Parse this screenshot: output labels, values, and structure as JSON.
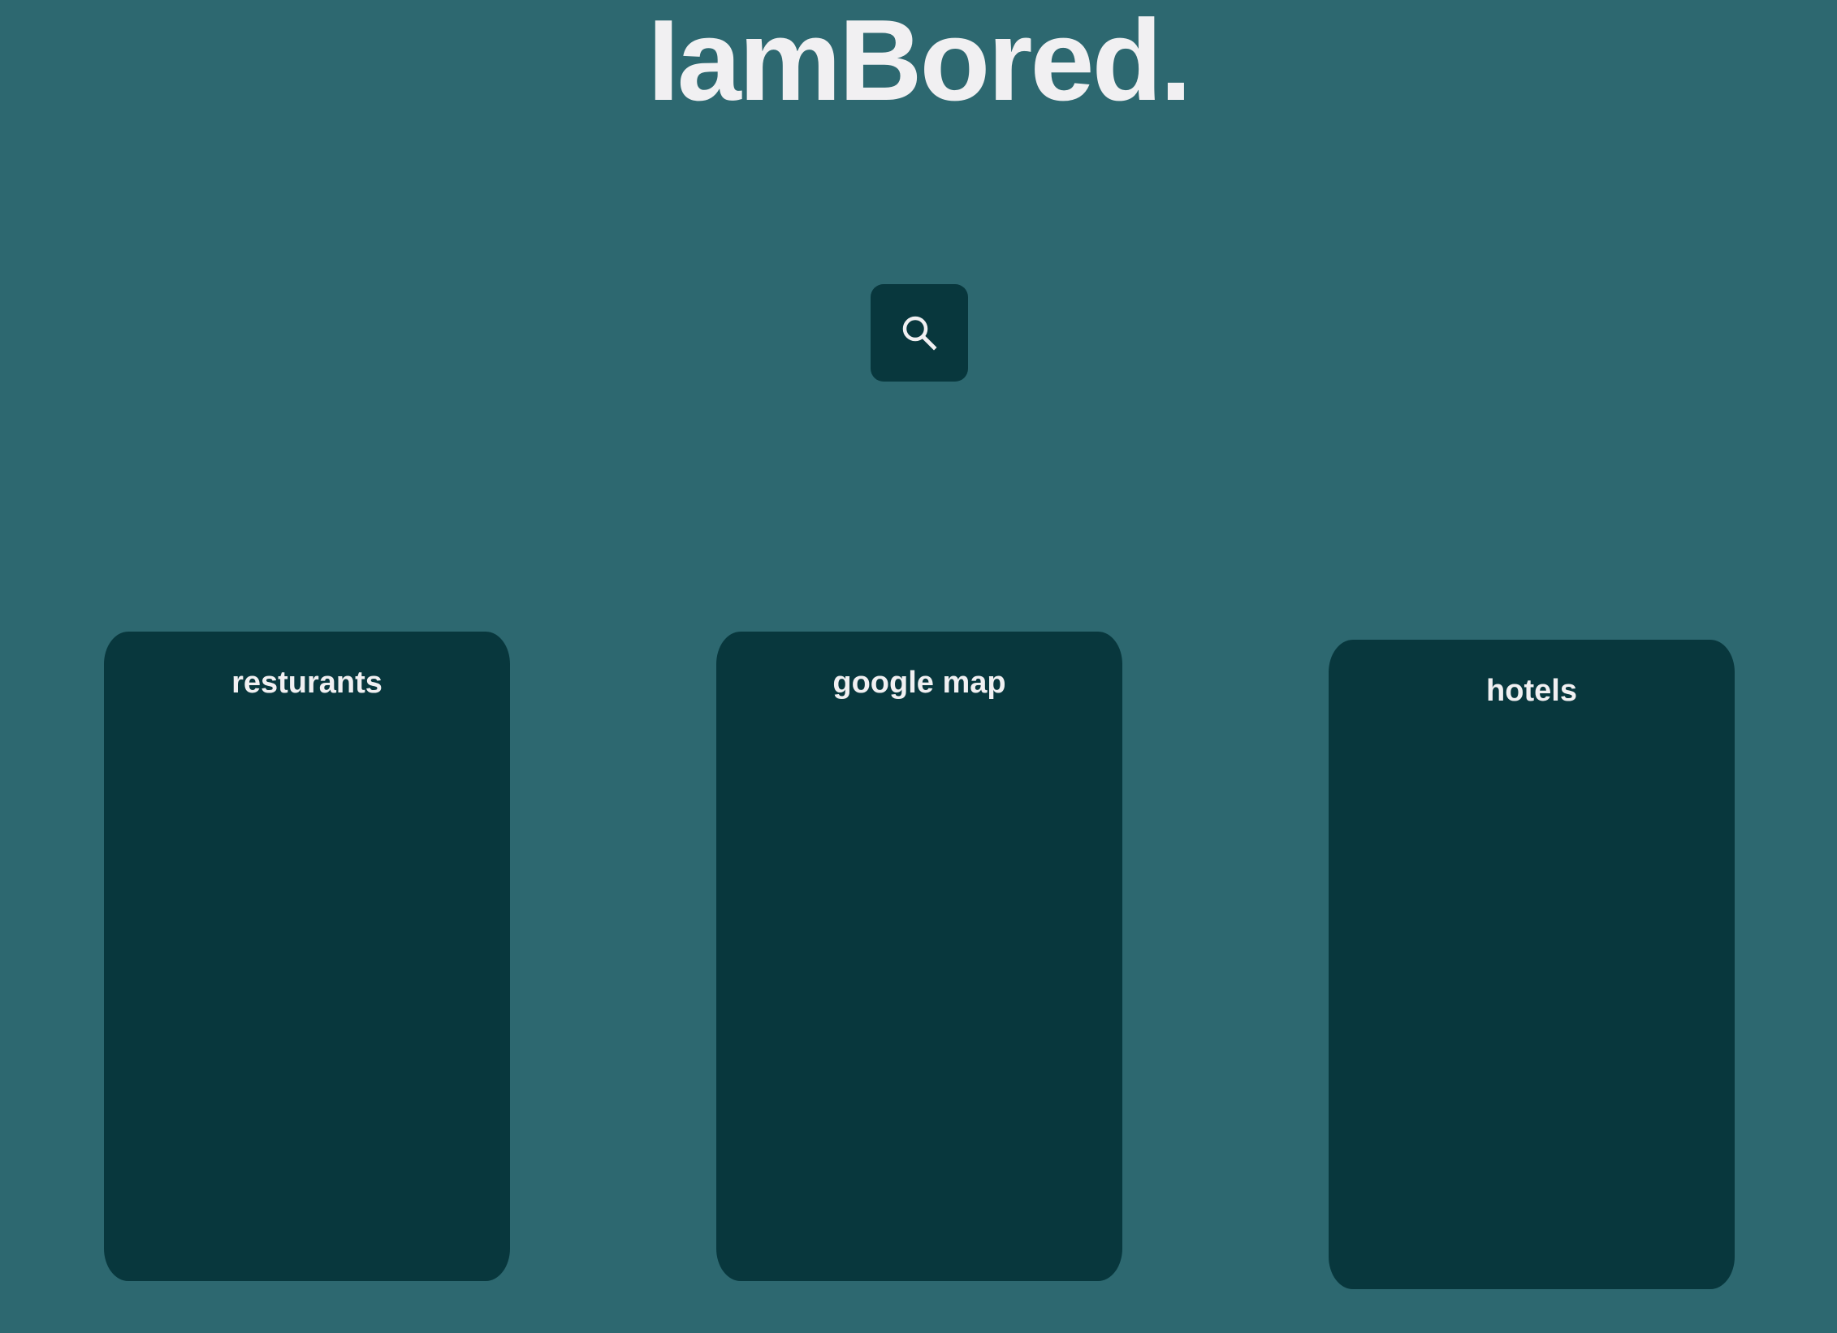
{
  "header": {
    "title": "IamBored."
  },
  "search": {
    "icon": "search-icon",
    "aria_label": "Search"
  },
  "cards": [
    {
      "label": "resturants"
    },
    {
      "label": "google map"
    },
    {
      "label": "hotels"
    }
  ],
  "colors": {
    "background": "#2d6870",
    "panel": "#08373d",
    "text": "#f1f0f2"
  }
}
